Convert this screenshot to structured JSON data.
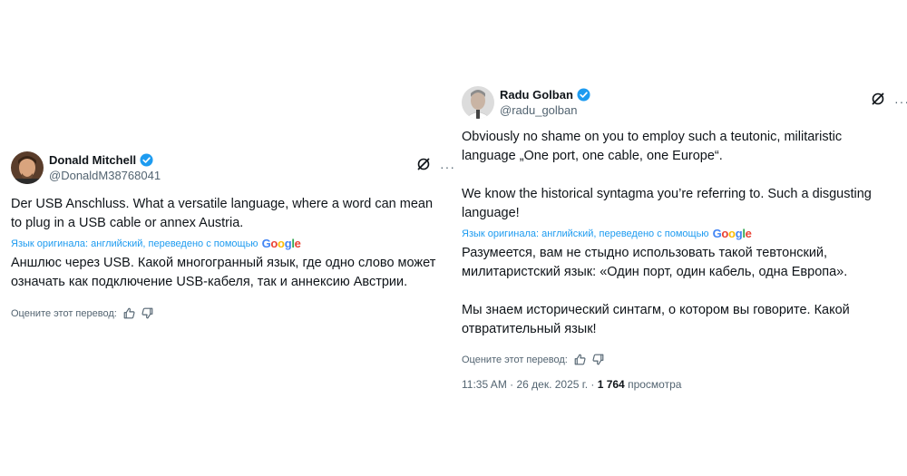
{
  "tweets": [
    {
      "name": "Donald Mitchell",
      "handle": "@DonaldM38768041",
      "original_lines": [
        "Der USB Anschluss.  What a versatile language, where a word can mean",
        "to plug in a USB cable or annex Austria."
      ],
      "translated_from": "Язык оригинала: английский, переведено с помощью",
      "translated_lines": [
        "Аншлюс через USB. Какой многогранный язык, где одно слово может",
        "означать как подключение USB-кабеля, так и аннексию Австрии."
      ],
      "rate_prompt": "Оцените этот перевод:"
    },
    {
      "name": "Radu Golban",
      "handle": "@radu_golban",
      "original_lines": [
        "Obviously no shame on you to employ such a teutonic, militaristic",
        "language „One port, one cable, one Europe“.",
        "",
        "We know the historical syntagma you’re referring to. Such a disgusting",
        "language!"
      ],
      "translated_from": "Язык оригинала: английский, переведено с помощью",
      "translated_lines": [
        "Разумеется, вам не стыдно использовать такой тевтонский,",
        "милитаристский язык: «Один порт, один кабель, одна Европа».",
        "",
        "Мы знаем исторический синтагм, о котором вы говорите. Какой",
        "отвратительный язык!"
      ],
      "rate_prompt": "Оцените этот перевод:",
      "timestamp": "11:35 AM · 26 дек. 2025 г. ·",
      "views_count": "1 764",
      "views_label": "просмотра"
    }
  ],
  "google_word": "Google",
  "google_colors": [
    "#4285F4",
    "#EA4335",
    "#FBBC05",
    "#4285F4",
    "#34A853",
    "#EA4335"
  ],
  "accent_color": "#1d9bf0",
  "icons": [
    "verified-badge-icon",
    "grok-slash-icon",
    "more-icon",
    "thumbs-up-icon",
    "thumbs-down-icon"
  ]
}
